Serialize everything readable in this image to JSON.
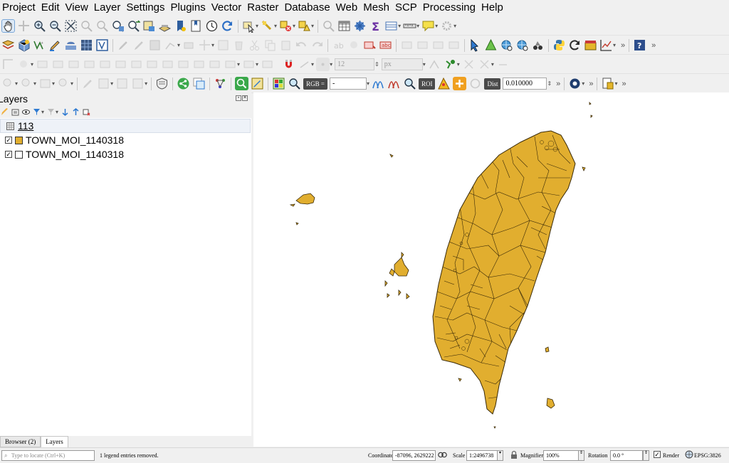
{
  "menu": [
    "Project",
    "Edit",
    "View",
    "Layer",
    "Settings",
    "Plugins",
    "Vector",
    "Raster",
    "Database",
    "Web",
    "Mesh",
    "SCP",
    "Processing",
    "Help"
  ],
  "toolbar3": {
    "font_size": "12",
    "unit": "px"
  },
  "toolbar4": {
    "rgb_label": "RGB =",
    "rgb_value": "-",
    "roi_label": "ROI",
    "dist_label": "Dist",
    "dist_value": "0.010000"
  },
  "layers_panel": {
    "title": "Layers",
    "items": [
      {
        "kind": "group",
        "name": "113"
      },
      {
        "kind": "layer",
        "name": "TOWN_MOI_1140318",
        "checked": "✓",
        "fill": "#e1ae2f"
      },
      {
        "kind": "layer",
        "name": "TOWN_MOI_1140318",
        "checked": "✓",
        "fill": "#ffffff"
      }
    ]
  },
  "bottom_tabs": [
    "Browser (2)",
    "Layers"
  ],
  "statusbar": {
    "locate_placeholder": "Type to locate (Ctrl+K)",
    "message": "1 legend entries removed.",
    "coordinate_label": "Coordinate",
    "coordinate_value": "-87096, 2629222",
    "scale_label": "Scale",
    "scale_value": "1:2496738",
    "magnifier_label": "Magnifier",
    "magnifier_value": "100%",
    "rotation_label": "Rotation",
    "rotation_value": "0.0 °",
    "render_label": "Render",
    "render_checked": "✓",
    "crs": "EPSG:3826"
  },
  "colors": {
    "map_fill": "#e1ae2f",
    "map_stroke": "#3a2a08",
    "accent": "#2f7fd1"
  }
}
